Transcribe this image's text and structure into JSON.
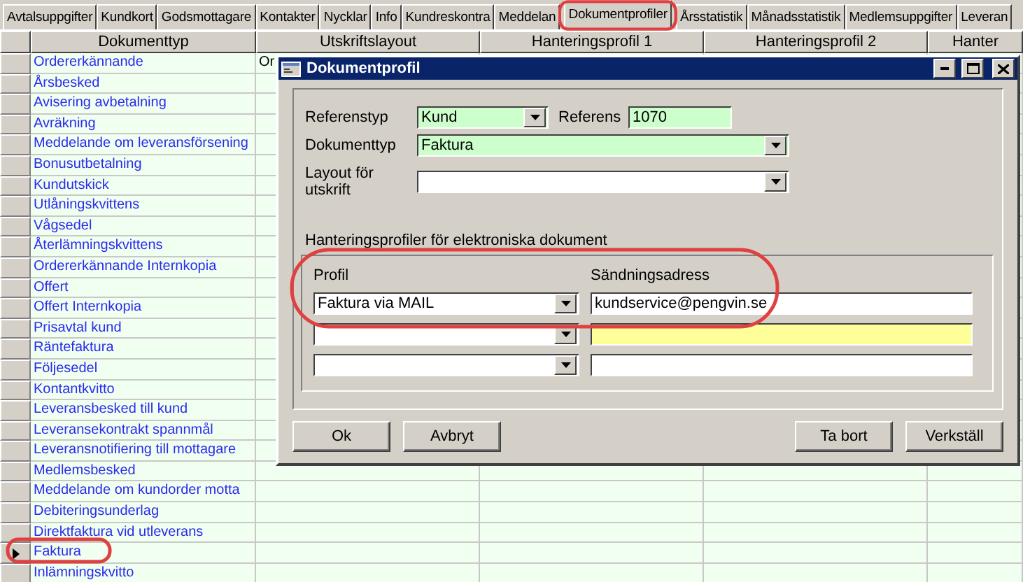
{
  "tabs": [
    {
      "label": "Avtalsuppgifter",
      "selected": false
    },
    {
      "label": "Kundkort",
      "selected": false
    },
    {
      "label": "Godsmottagare",
      "selected": false
    },
    {
      "label": "Kontakter",
      "selected": false
    },
    {
      "label": "Nycklar",
      "selected": false
    },
    {
      "label": "Info",
      "selected": false
    },
    {
      "label": "Kundreskontra",
      "selected": false
    },
    {
      "label": "Meddelan",
      "selected": false
    },
    {
      "label": "Dokumentprofiler",
      "selected": true
    },
    {
      "label": "Årsstatistik",
      "selected": false
    },
    {
      "label": "Månadsstatistik",
      "selected": false
    },
    {
      "label": "Medlemsuppgifter",
      "selected": false
    },
    {
      "label": "Leveran",
      "selected": false
    }
  ],
  "grid": {
    "columns": [
      "Dokumenttyp",
      "Utskriftslayout",
      "Hanteringsprofil 1",
      "Hanteringsprofil 2",
      "Hanter"
    ],
    "rows": [
      {
        "dokumenttyp": "Ordererkännande",
        "utskriftslayout": "Or",
        "current": false
      },
      {
        "dokumenttyp": "Årsbesked",
        "current": false
      },
      {
        "dokumenttyp": "Avisering avbetalning",
        "current": false
      },
      {
        "dokumenttyp": "Avräkning",
        "current": false
      },
      {
        "dokumenttyp": "Meddelande om leveransförsening",
        "current": false
      },
      {
        "dokumenttyp": "Bonusutbetalning",
        "current": false
      },
      {
        "dokumenttyp": "Kundutskick",
        "current": false
      },
      {
        "dokumenttyp": "Utlåningskvittens",
        "current": false
      },
      {
        "dokumenttyp": "Vågsedel",
        "current": false
      },
      {
        "dokumenttyp": "Återlämningskvittens",
        "current": false
      },
      {
        "dokumenttyp": "Ordererkännande Internkopia",
        "current": false
      },
      {
        "dokumenttyp": "Offert",
        "current": false
      },
      {
        "dokumenttyp": "Offert Internkopia",
        "current": false
      },
      {
        "dokumenttyp": "Prisavtal kund",
        "current": false
      },
      {
        "dokumenttyp": "Räntefaktura",
        "current": false
      },
      {
        "dokumenttyp": "Följesedel",
        "current": false
      },
      {
        "dokumenttyp": "Kontantkvitto",
        "current": false
      },
      {
        "dokumenttyp": "Leveransbesked till kund",
        "current": false
      },
      {
        "dokumenttyp": "Leveransekontrakt spannmål",
        "current": false
      },
      {
        "dokumenttyp": "Leveransnotifiering till mottagare",
        "current": false
      },
      {
        "dokumenttyp": "Medlemsbesked",
        "current": false
      },
      {
        "dokumenttyp": "Meddelande om kundorder motta",
        "current": false
      },
      {
        "dokumenttyp": "Debiteringsunderlag",
        "current": false
      },
      {
        "dokumenttyp": "Direktfaktura vid utleverans",
        "current": false
      },
      {
        "dokumenttyp": "Faktura",
        "current": true
      },
      {
        "dokumenttyp": "Inlämningskvitto",
        "current": false
      }
    ]
  },
  "dialog": {
    "title": "Dokumentprofil",
    "referenstyp": {
      "label": "Referenstyp",
      "value": "Kund",
      "required": true
    },
    "referens": {
      "label": "Referens",
      "value": "1070",
      "required": true
    },
    "dokumenttyp": {
      "label": "Dokumenttyp",
      "value": "Faktura",
      "required": true
    },
    "layout": {
      "label": "Layout för utskrift",
      "required": false
    },
    "section_label": "Hanteringsprofiler för elektroniska dokument",
    "profile_columns": [
      "Profil",
      "Sändningsadress"
    ],
    "profiles": [
      {
        "profil": "Faktura via MAIL",
        "address": "kundservice@pengvin.se",
        "focused": false
      },
      {
        "focused": true
      },
      {
        "focused": false
      }
    ],
    "buttons_left": [
      "Ok",
      "Avbryt"
    ],
    "buttons_right": [
      "Ta bort",
      "Verkställ"
    ]
  }
}
